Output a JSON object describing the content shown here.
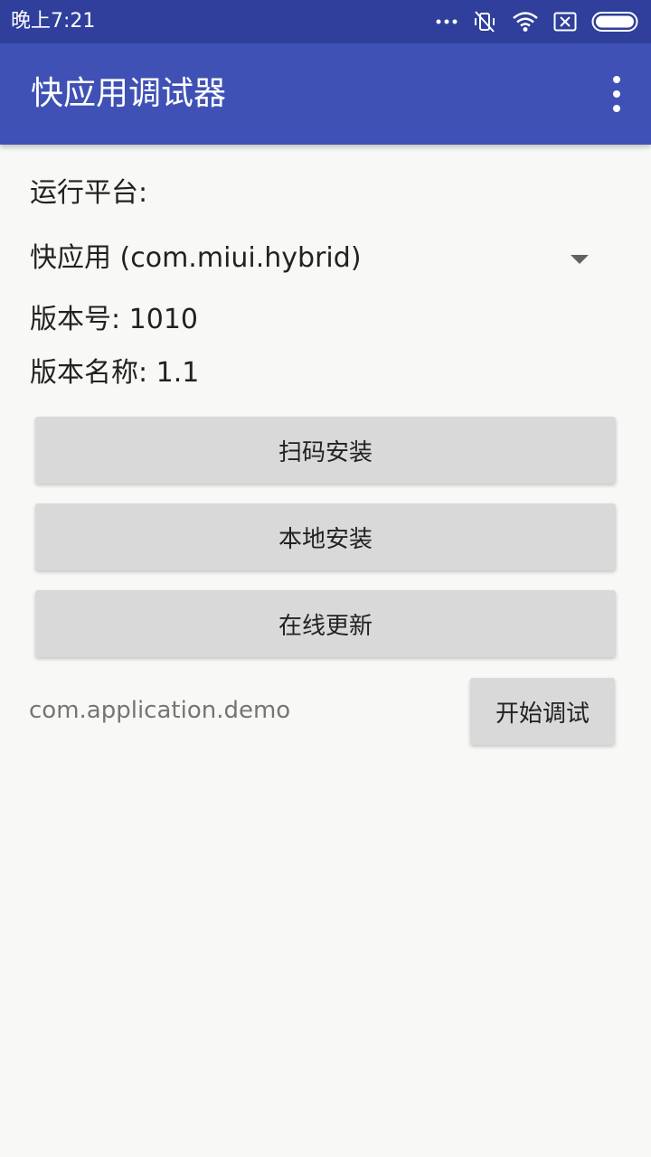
{
  "status_bar": {
    "time": "晚上7:21",
    "icons": [
      "more-dots-icon",
      "vibrate-off-icon",
      "wifi-icon",
      "sim-x-icon",
      "battery-icon"
    ]
  },
  "app_bar": {
    "title": "快应用调试器",
    "menu_icon": "overflow-menu-icon"
  },
  "main": {
    "platform_label": "运行平台:",
    "platform_selected": "快应用 (com.miui.hybrid)",
    "version_code": "版本号: 1010",
    "version_name": "版本名称: 1.1",
    "buttons": {
      "scan_install": "扫码安装",
      "local_install": "本地安装",
      "online_update": "在线更新"
    },
    "package_name": "com.application.demo",
    "start_debug": "开始调试"
  },
  "colors": {
    "status_bar": "#2f3f9b",
    "app_bar": "#3f51b5",
    "background": "#f8f8f6",
    "button": "#d9d9d9"
  }
}
